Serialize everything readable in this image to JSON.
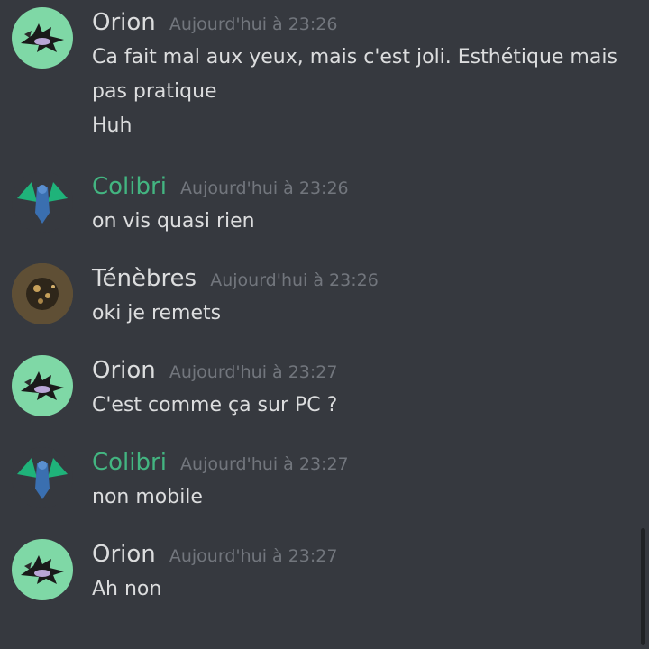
{
  "colors": {
    "background": "#36393f",
    "orion": "#dcddde",
    "colibri": "#43b581",
    "tenebres": "#dcddde",
    "timestamp": "#72767d",
    "text": "#dcddde"
  },
  "messages": [
    {
      "author": "Orion",
      "timestamp": "Aujourd'hui à 23:26",
      "avatar": "orion-dragon-avatar",
      "lines": [
        "Ca fait mal aux yeux, mais c'est joli. Esthétique mais",
        "pas pratique",
        "Huh"
      ]
    },
    {
      "author": "Colibri",
      "timestamp": "Aujourd'hui à 23:26",
      "avatar": "colibri-dragon-avatar",
      "lines": [
        "on vis quasi rien"
      ]
    },
    {
      "author": "Ténèbres",
      "timestamp": "Aujourd'hui à 23:26",
      "avatar": "tenebres-photo-avatar",
      "lines": [
        "oki je remets"
      ]
    },
    {
      "author": "Orion",
      "timestamp": "Aujourd'hui à 23:27",
      "avatar": "orion-dragon-avatar",
      "lines": [
        "C'est comme ça sur PC ?"
      ]
    },
    {
      "author": "Colibri",
      "timestamp": "Aujourd'hui à 23:27",
      "avatar": "colibri-dragon-avatar",
      "lines": [
        "non mobile"
      ]
    },
    {
      "author": "Orion",
      "timestamp": "Aujourd'hui à 23:27",
      "avatar": "orion-dragon-avatar",
      "lines": [
        "Ah non"
      ]
    }
  ]
}
